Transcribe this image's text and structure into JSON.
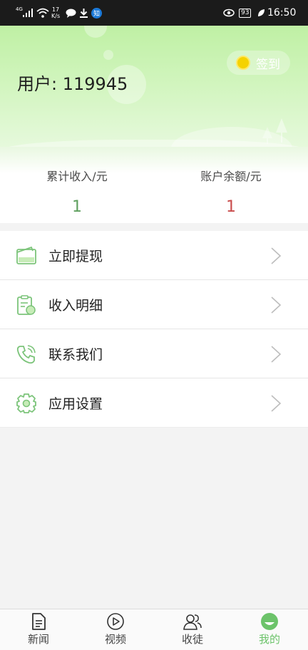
{
  "status_bar": {
    "network": "4G",
    "speed_value": "17",
    "speed_unit": "K/s",
    "notification_badge": "知",
    "battery": "93",
    "time": "16:50"
  },
  "header": {
    "username": "用户: 119945",
    "checkin_label": "签到"
  },
  "stats": {
    "income_label": "累计收入/元",
    "income_value": "1",
    "balance_label": "账户余额/元",
    "balance_value": "1"
  },
  "menu": [
    {
      "label": "立即提现",
      "icon": "wallet-icon"
    },
    {
      "label": "收入明细",
      "icon": "clipboard-money-icon"
    },
    {
      "label": "联系我们",
      "icon": "phone-icon"
    },
    {
      "label": "应用设置",
      "icon": "gear-icon"
    }
  ],
  "nav": [
    {
      "label": "新闻",
      "icon": "document-icon"
    },
    {
      "label": "视频",
      "icon": "play-icon"
    },
    {
      "label": "收徒",
      "icon": "users-icon"
    },
    {
      "label": "我的",
      "icon": "profile-icon"
    }
  ],
  "colors": {
    "accent": "#6cc36a",
    "income": "#5fa05f",
    "balance": "#c94c4c"
  }
}
